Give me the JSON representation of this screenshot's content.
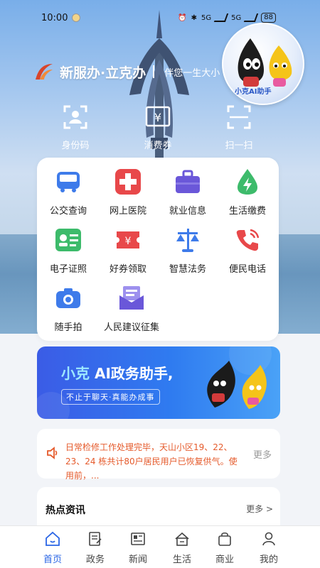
{
  "status_bar": {
    "time": "10:00",
    "battery": "88",
    "network_1": "5G",
    "network_2": "5G"
  },
  "brand": {
    "title": "新服办·立克办",
    "slogan": "伴您一生大小"
  },
  "assistant_bubble": {
    "label": "小克AI助手"
  },
  "quick_actions": [
    {
      "label": "身份码",
      "icon": "id-card-scan-icon"
    },
    {
      "label": "消费券",
      "icon": "yuan-coupon-icon"
    },
    {
      "label": "扫一扫",
      "icon": "scan-frame-icon"
    }
  ],
  "services": [
    {
      "label": "公交查询",
      "icon": "bus-icon",
      "color": "#3e7bea"
    },
    {
      "label": "网上医院",
      "icon": "hospital-cross-icon",
      "color": "#e8484a"
    },
    {
      "label": "就业信息",
      "icon": "briefcase-icon",
      "color": "#6a57d9"
    },
    {
      "label": "生活缴费",
      "icon": "lightning-drop-icon",
      "color": "#3dbb6b"
    },
    {
      "label": "电子证照",
      "icon": "id-license-icon",
      "color": "#3dbb6b"
    },
    {
      "label": "好券领取",
      "icon": "coupon-ticket-icon",
      "color": "#e8484a"
    },
    {
      "label": "智慧法务",
      "icon": "scales-icon",
      "color": "#3e7bea"
    },
    {
      "label": "便民电话",
      "icon": "phone-icon",
      "color": "#e8484a"
    },
    {
      "label": "随手拍",
      "icon": "camera-icon",
      "color": "#3e7bea"
    },
    {
      "label": "人民建议征集",
      "icon": "mail-envelope-icon",
      "color": "#6a57d9"
    }
  ],
  "banner": {
    "title_highlight": "小克",
    "title_rest": " AI政务助手,",
    "subtitle": "不止于聊天·真能办成事"
  },
  "notice": {
    "text": "日常检修工作处理完毕，天山小区19、22、23、24 栋共计80户居民用户已恢复供气。使用前，...",
    "more": "更多"
  },
  "hot_news": {
    "title": "热点资讯",
    "more": "更多 >"
  },
  "tabs": [
    {
      "label": "首页",
      "icon": "home-icon",
      "active": true
    },
    {
      "label": "政务",
      "icon": "document-icon",
      "active": false
    },
    {
      "label": "新闻",
      "icon": "newspaper-icon",
      "active": false
    },
    {
      "label": "生活",
      "icon": "house-icon",
      "active": false
    },
    {
      "label": "商业",
      "icon": "shopping-bag-icon",
      "active": false
    },
    {
      "label": "我的",
      "icon": "person-icon",
      "active": false
    }
  ],
  "colors": {
    "accent": "#2a65e5",
    "notice": "#e55a2b"
  }
}
